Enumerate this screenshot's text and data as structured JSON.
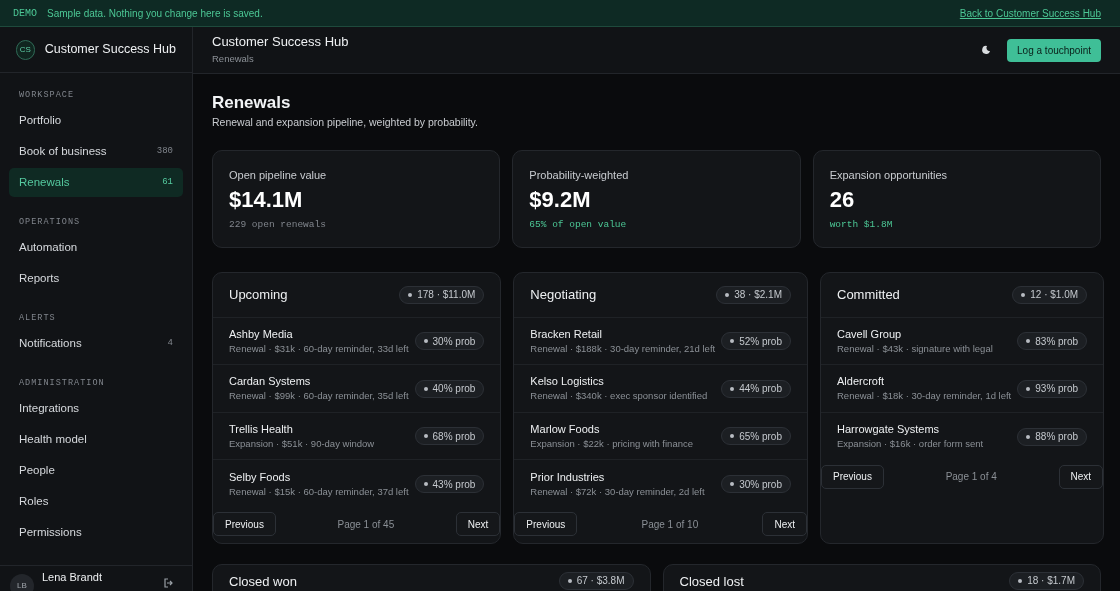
{
  "banner": {
    "tag": "DEMO",
    "message": "Sample data. Nothing you change here is saved.",
    "link": "Back to Customer Success Hub"
  },
  "sidebar": {
    "logo": "CS",
    "app_name": "Customer Success Hub",
    "sections": [
      {
        "title": "WORKSPACE",
        "items": [
          {
            "label": "Portfolio",
            "selected": false
          },
          {
            "label": "Book of business",
            "count": "380",
            "selected": false
          },
          {
            "label": "Renewals",
            "count": "61",
            "selected": true
          }
        ]
      },
      {
        "title": "OPERATIONS",
        "items": [
          {
            "label": "Automation",
            "selected": false
          },
          {
            "label": "Reports",
            "selected": false
          }
        ]
      },
      {
        "title": "ALERTS",
        "items": [
          {
            "label": "Notifications",
            "count": "4",
            "selected": false
          }
        ]
      },
      {
        "title": "ADMINISTRATION",
        "items": [
          {
            "label": "Integrations",
            "selected": false
          },
          {
            "label": "Health model",
            "selected": false
          },
          {
            "label": "People",
            "selected": false
          },
          {
            "label": "Roles",
            "selected": false
          },
          {
            "label": "Permissions",
            "selected": false
          }
        ]
      }
    ],
    "user": {
      "initials": "LB",
      "name": "Lena Brandt"
    }
  },
  "header": {
    "title": "Customer Success Hub",
    "breadcrumb": "Renewals",
    "action": "Log a touchpoint"
  },
  "page": {
    "title": "Renewals",
    "subtitle": "Renewal and expansion pipeline, weighted by probability."
  },
  "stats": [
    {
      "label": "Open pipeline value",
      "value": "$14.1M",
      "note": "229 open renewals",
      "kind": "muted"
    },
    {
      "label": "Probability-weighted",
      "value": "$9.2M",
      "note": "65% of open value",
      "kind": "positive"
    },
    {
      "label": "Expansion opportunities",
      "value": "26",
      "note": "worth $1.8M",
      "kind": "positive"
    }
  ],
  "columns": [
    {
      "title": "Upcoming",
      "summary": "178 · $11.0M",
      "rows": [
        {
          "name": "Ashby Media",
          "detail": "Renewal · $31k · 60-day reminder, 33d left",
          "prob": "30% prob"
        },
        {
          "name": "Cardan Systems",
          "detail": "Renewal · $99k · 60-day reminder, 35d left",
          "prob": "40% prob"
        },
        {
          "name": "Trellis Health",
          "detail": "Expansion · $51k · 90-day window",
          "prob": "68% prob"
        },
        {
          "name": "Selby Foods",
          "detail": "Renewal · $15k · 60-day reminder, 37d left",
          "prob": "43% prob"
        }
      ],
      "pager": {
        "previous": "Previous",
        "page": "Page 1 of 45",
        "next": "Next"
      }
    },
    {
      "title": "Negotiating",
      "summary": "38 · $2.1M",
      "rows": [
        {
          "name": "Bracken Retail",
          "detail": "Renewal · $188k · 30-day reminder, 21d left",
          "prob": "52% prob"
        },
        {
          "name": "Kelso Logistics",
          "detail": "Renewal · $340k · exec sponsor identified",
          "prob": "44% prob"
        },
        {
          "name": "Marlow Foods",
          "detail": "Expansion · $22k · pricing with finance",
          "prob": "65% prob"
        },
        {
          "name": "Prior Industries",
          "detail": "Renewal · $72k · 30-day reminder, 2d left",
          "prob": "30% prob"
        }
      ],
      "pager": {
        "previous": "Previous",
        "page": "Page 1 of 10",
        "next": "Next"
      }
    },
    {
      "title": "Committed",
      "summary": "12 · $1.0M",
      "rows": [
        {
          "name": "Cavell Group",
          "detail": "Renewal · $43k · signature with legal",
          "prob": "83% prob"
        },
        {
          "name": "Aldercroft",
          "detail": "Renewal · $18k · 30-day reminder, 1d left",
          "prob": "93% prob"
        },
        {
          "name": "Harrowgate Systems",
          "detail": "Expansion · $16k · order form sent",
          "prob": "88% prob"
        }
      ],
      "pager": {
        "previous": "Previous",
        "page": "Page 1 of 4",
        "next": "Next"
      }
    }
  ],
  "closed": [
    {
      "title": "Closed won",
      "summary": "67 · $3.8M"
    },
    {
      "title": "Closed lost",
      "summary": "18 · $1.7M"
    }
  ]
}
